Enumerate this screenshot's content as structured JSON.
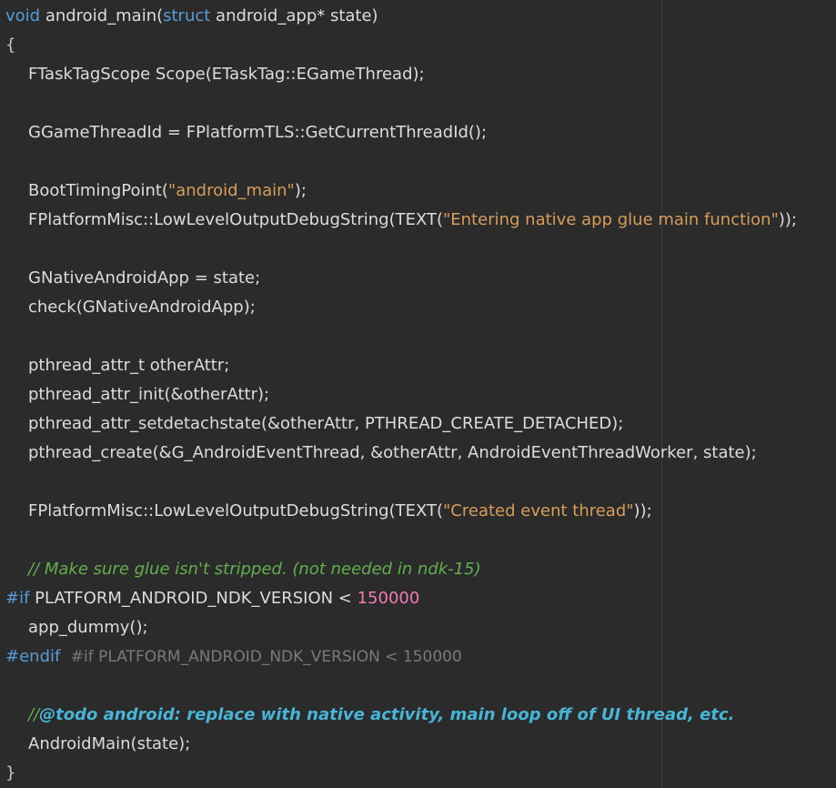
{
  "lines": {
    "l01": {
      "kw_void": "void",
      "fn_sig_a": " android_main(",
      "kw_struct": "struct",
      "fn_sig_b": " android_app* state)"
    },
    "l02": {
      "text": "{"
    },
    "l03": {
      "text": "FTaskTagScope Scope(ETaskTag::EGameThread);"
    },
    "l05": {
      "text": "GGameThreadId = FPlatformTLS::GetCurrentThreadId();"
    },
    "l07": {
      "pre": "BootTimingPoint(",
      "str": "\"android_main\"",
      "post": ");"
    },
    "l08": {
      "pre": "FPlatformMisc::LowLevelOutputDebugString(TEXT(",
      "str": "\"Entering native app glue main function\"",
      "post": "));"
    },
    "l10": {
      "text": "GNativeAndroidApp = state;"
    },
    "l11": {
      "text": "check(GNativeAndroidApp);"
    },
    "l13": {
      "text": "pthread_attr_t otherAttr;"
    },
    "l14": {
      "text": "pthread_attr_init(&otherAttr);"
    },
    "l15": {
      "text": "pthread_attr_setdetachstate(&otherAttr, PTHREAD_CREATE_DETACHED);"
    },
    "l16": {
      "text": "pthread_create(&G_AndroidEventThread, &otherAttr, AndroidEventThreadWorker, state);"
    },
    "l18": {
      "pre": "FPlatformMisc::LowLevelOutputDebugString(TEXT(",
      "str": "\"Created event thread\"",
      "post": "));"
    },
    "l20": {
      "comment": "// Make sure glue isn't stripped. (not needed in ndk-15)"
    },
    "l21": {
      "directive": "#if",
      "cond": " PLATFORM_ANDROID_NDK_VERSION < ",
      "num": "150000"
    },
    "l22": {
      "text": "app_dummy();"
    },
    "l23": {
      "directive": "#endif",
      "hint": "#if PLATFORM_ANDROID_NDK_VERSION < 150000"
    },
    "l25": {
      "comment_prefix": "//",
      "todo": "@todo android: replace with native activity, main loop off of UI thread, etc."
    },
    "l26": {
      "text": "AndroidMain(state);"
    },
    "l27": {
      "text": "}"
    }
  },
  "colors": {
    "background": "#2b2b2b",
    "text": "#dcdcdc",
    "keyword": "#569cd6",
    "string": "#d69d5a",
    "number": "#f07cb4",
    "comment": "#65ad4f",
    "todo": "#47b5d8",
    "inlay_hint": "#7a7a7a"
  }
}
